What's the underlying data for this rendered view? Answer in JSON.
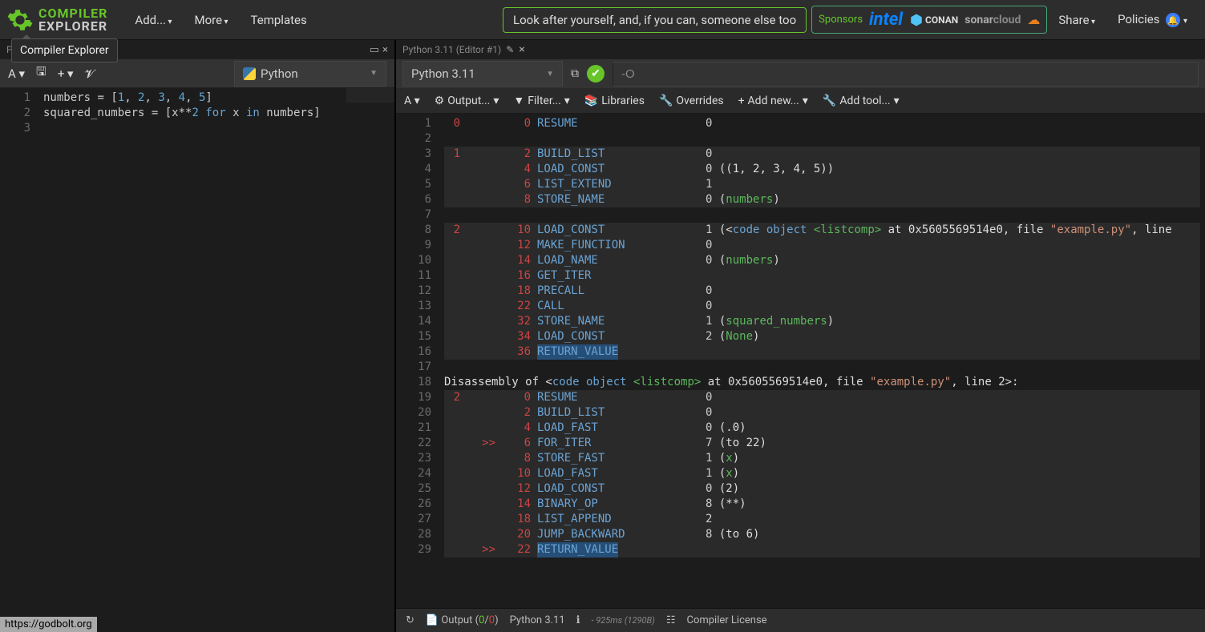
{
  "brand": {
    "top": "COMPILER",
    "bottom": "EXPLORER"
  },
  "nav": {
    "add": "Add...",
    "more": "More",
    "templates": "Templates",
    "share": "Share",
    "policies": "Policies"
  },
  "motd": "Look after yourself, and, if you can, someone else too",
  "sponsors": {
    "label": "Sponsors",
    "intel": "intel",
    "conan": "CONAN",
    "sonar": "sonarcloud"
  },
  "tooltip": "Compiler Explorer",
  "editor": {
    "tab": "Python source #1",
    "language": "Python",
    "lines": [
      {
        "n": "1",
        "tokens": [
          [
            "id",
            "numbers"
          ],
          [
            "op",
            " = "
          ],
          [
            "punc",
            "["
          ],
          [
            "num",
            "1"
          ],
          [
            "punc",
            ", "
          ],
          [
            "num",
            "2"
          ],
          [
            "punc",
            ", "
          ],
          [
            "num",
            "3"
          ],
          [
            "punc",
            ", "
          ],
          [
            "num",
            "4"
          ],
          [
            "punc",
            ", "
          ],
          [
            "num",
            "5"
          ],
          [
            "punc",
            "]"
          ]
        ]
      },
      {
        "n": "2",
        "tokens": [
          [
            "id",
            "squared_numbers"
          ],
          [
            "op",
            " = "
          ],
          [
            "punc",
            "["
          ],
          [
            "id",
            "x"
          ],
          [
            "op",
            "**"
          ],
          [
            "num",
            "2"
          ],
          [
            "op",
            " "
          ],
          [
            "kw",
            "for"
          ],
          [
            "op",
            " "
          ],
          [
            "id",
            "x"
          ],
          [
            "op",
            " "
          ],
          [
            "kw",
            "in"
          ],
          [
            "op",
            " "
          ],
          [
            "id",
            "numbers"
          ],
          [
            "punc",
            "]"
          ]
        ]
      },
      {
        "n": "3",
        "tokens": []
      }
    ]
  },
  "compiler": {
    "tab": "Python 3.11 (Editor #1)",
    "name": "Python 3.11",
    "options": "-O",
    "subtoolbar": {
      "output": "Output...",
      "filter": "Filter...",
      "libraries": "Libraries",
      "overrides": "Overrides",
      "addnew": "Add new...",
      "addtool": "Add tool..."
    },
    "asm_lines": [
      {
        "n": "1",
        "src": "0",
        "mark": "",
        "off": "0",
        "op": "RESUME",
        "arg": "0",
        "rest": ""
      },
      {
        "n": "2",
        "src": "",
        "mark": "",
        "off": "",
        "op": "",
        "arg": "",
        "rest": ""
      },
      {
        "n": "3",
        "src": "1",
        "mark": "",
        "off": "2",
        "op": "BUILD_LIST",
        "arg": "0",
        "rest": "",
        "bg": 1
      },
      {
        "n": "4",
        "src": "",
        "mark": "",
        "off": "4",
        "op": "LOAD_CONST",
        "arg": "0",
        "rest": " ((1, 2, 3, 4, 5))",
        "bg": 1
      },
      {
        "n": "5",
        "src": "",
        "mark": "",
        "off": "6",
        "op": "LIST_EXTEND",
        "arg": "1",
        "rest": "",
        "bg": 1
      },
      {
        "n": "6",
        "src": "",
        "mark": "",
        "off": "8",
        "op": "STORE_NAME",
        "arg": "0",
        "rest": " (",
        "name": "numbers",
        "tail": ")",
        "bg": 1
      },
      {
        "n": "7",
        "src": "",
        "mark": "",
        "off": "",
        "op": "",
        "arg": "",
        "rest": ""
      },
      {
        "n": "8",
        "src": "2",
        "mark": "",
        "off": "10",
        "op": "LOAD_CONST",
        "arg": "1",
        "rest": " (<",
        "kw1": "code object ",
        "name": "<listcomp>",
        "mid": " at 0x5605569514e0, file ",
        "str": "\"example.py\"",
        "tail2": ", line",
        "bg": 1
      },
      {
        "n": "9",
        "src": "",
        "mark": "",
        "off": "12",
        "op": "MAKE_FUNCTION",
        "arg": "0",
        "rest": "",
        "bg": 1
      },
      {
        "n": "10",
        "src": "",
        "mark": "",
        "off": "14",
        "op": "LOAD_NAME",
        "arg": "0",
        "rest": " (",
        "name": "numbers",
        "tail": ")",
        "bg": 1
      },
      {
        "n": "11",
        "src": "",
        "mark": "",
        "off": "16",
        "op": "GET_ITER",
        "arg": "",
        "rest": "",
        "bg": 1
      },
      {
        "n": "12",
        "src": "",
        "mark": "",
        "off": "18",
        "op": "PRECALL",
        "arg": "0",
        "rest": "",
        "bg": 1
      },
      {
        "n": "13",
        "src": "",
        "mark": "",
        "off": "22",
        "op": "CALL",
        "arg": "0",
        "rest": "",
        "bg": 1
      },
      {
        "n": "14",
        "src": "",
        "mark": "",
        "off": "32",
        "op": "STORE_NAME",
        "arg": "1",
        "rest": " (",
        "name": "squared_numbers",
        "tail": ")",
        "bg": 1
      },
      {
        "n": "15",
        "src": "",
        "mark": "",
        "off": "34",
        "op": "LOAD_CONST",
        "arg": "2",
        "rest": " (",
        "name": "None",
        "tail": ")",
        "bg": 1
      },
      {
        "n": "16",
        "src": "",
        "mark": "",
        "off": "36",
        "op": "RETURN_VALUE",
        "arg": "",
        "rest": "",
        "bg": 1,
        "sel_op": 1
      },
      {
        "n": "17",
        "src": "",
        "mark": "",
        "off": "",
        "op": "",
        "arg": "",
        "rest": ""
      },
      {
        "n": "18",
        "disasm": "Disassembly of <code object <listcomp> at 0x5605569514e0, file \"example.py\", line 2>:"
      },
      {
        "n": "19",
        "src": "2",
        "mark": "",
        "off": "0",
        "op": "RESUME",
        "arg": "0",
        "rest": "",
        "bg": 1
      },
      {
        "n": "20",
        "src": "",
        "mark": "",
        "off": "2",
        "op": "BUILD_LIST",
        "arg": "0",
        "rest": "",
        "bg": 1
      },
      {
        "n": "21",
        "src": "",
        "mark": "",
        "off": "4",
        "op": "LOAD_FAST",
        "arg": "0",
        "rest": " (.0)",
        "bg": 1
      },
      {
        "n": "22",
        "src": "",
        "mark": ">>",
        "off": "6",
        "op": "FOR_ITER",
        "arg": "7",
        "rest": " (to 22)",
        "bg": 1
      },
      {
        "n": "23",
        "src": "",
        "mark": "",
        "off": "8",
        "op": "STORE_FAST",
        "arg": "1",
        "rest": " (",
        "name": "x",
        "tail": ")",
        "bg": 1
      },
      {
        "n": "24",
        "src": "",
        "mark": "",
        "off": "10",
        "op": "LOAD_FAST",
        "arg": "1",
        "rest": " (",
        "name": "x",
        "tail": ")",
        "bg": 1
      },
      {
        "n": "25",
        "src": "",
        "mark": "",
        "off": "12",
        "op": "LOAD_CONST",
        "arg": "0",
        "rest": " (2)",
        "bg": 1
      },
      {
        "n": "26",
        "src": "",
        "mark": "",
        "off": "14",
        "op": "BINARY_OP",
        "arg": "8",
        "rest": " (**)",
        "bg": 1
      },
      {
        "n": "27",
        "src": "",
        "mark": "",
        "off": "18",
        "op": "LIST_APPEND",
        "arg": "2",
        "rest": "",
        "bg": 1
      },
      {
        "n": "28",
        "src": "",
        "mark": "",
        "off": "20",
        "op": "JUMP_BACKWARD",
        "arg": "8",
        "rest": " (to 6)",
        "bg": 1
      },
      {
        "n": "29",
        "src": "",
        "mark": ">>",
        "off": "22",
        "op": "RETURN_VALUE",
        "arg": "",
        "rest": "",
        "bg": 1,
        "sel_op": 1
      }
    ]
  },
  "status": {
    "output_label": "Output",
    "output_ok": "0",
    "output_fail": "0",
    "compiler": "Python 3.11",
    "timing": "- 925ms (1290B)",
    "license": "Compiler License"
  },
  "footer_url": "https://godbolt.org"
}
